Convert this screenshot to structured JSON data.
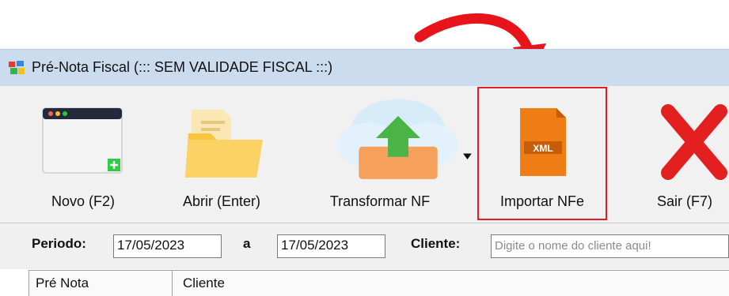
{
  "window": {
    "title": "Pré-Nota Fiscal (::: SEM VALIDADE FISCAL :::)"
  },
  "toolbar": {
    "buttons": [
      {
        "label": "Novo (F2)",
        "icon": "new-window-icon"
      },
      {
        "label": "Abrir (Enter)",
        "icon": "folder-icon"
      },
      {
        "label": "Transformar NF",
        "icon": "cloud-upload-icon"
      },
      {
        "label": "Importar NFe",
        "icon": "xml-file-icon",
        "badge": "XML"
      },
      {
        "label": "Sair (F7)",
        "icon": "close-icon"
      }
    ]
  },
  "filters": {
    "periodo_label": "Periodo:",
    "date_from": "17/05/2023",
    "separator": "a",
    "date_to": "17/05/2023",
    "cliente_label": "Cliente:",
    "cliente_placeholder": "Digite o nome do cliente aqui!"
  },
  "grid": {
    "columns": [
      "Pré Nota",
      "Cliente"
    ]
  },
  "colors": {
    "highlight": "#e02020",
    "arrow": "#e8141b",
    "titlebar": "#ccdcef"
  }
}
